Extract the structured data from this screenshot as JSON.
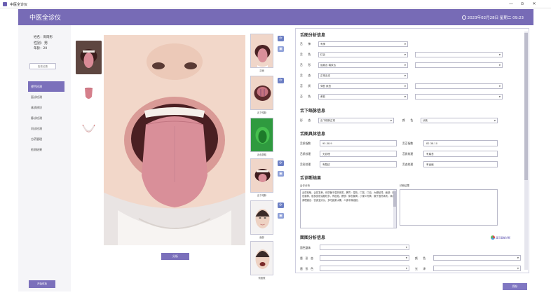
{
  "window": {
    "title": "中医全诊仪",
    "controls": {
      "minimize": "—",
      "restore": "⊙",
      "close": "✕"
    }
  },
  "header": {
    "title": "中医全诊仪",
    "datetime": "2023年02月28日 星期二 09:23"
  },
  "patient": {
    "name": "姓名：周雨彤",
    "gender": "性别：男",
    "age": "年龄：20"
  },
  "sidebar": {
    "history_button": "历史记录",
    "nav": [
      "望舌检测",
      "面诊检测",
      "体质辨识",
      "脉诊检测",
      "问诊检测",
      "方药管理",
      "检测结果"
    ],
    "active_index": 0,
    "reset_button": "开始体检"
  },
  "main": {
    "analyze_button": "分析"
  },
  "thumbs": {
    "labels": [
      "正面",
      "舌下络脉",
      "舌色提取",
      "舌下络脉",
      "面部",
      "侧面照"
    ]
  },
  "panel": {
    "tongue_section": {
      "title": "舌图分析信息",
      "rows": [
        {
          "label": "舌　　神",
          "value": "有神",
          "extra": false
        },
        {
          "label": "舌　　色",
          "value": "红舌",
          "extra": true
        },
        {
          "label": "舌　　形",
          "value": "齿痕舌 裂纹舌",
          "extra": true
        },
        {
          "label": "舌　　态",
          "value": "正常舌态",
          "extra": false
        },
        {
          "label": "苔　　质",
          "value": "薄苔 腻苔",
          "extra": true
        },
        {
          "label": "苔　　色",
          "value": "黄苔",
          "extra": true
        }
      ]
    },
    "sublingual_section": {
      "title": "舌下络脉信息",
      "shape_label": "形　　态",
      "shape_value": "舌下络脉正常",
      "color_label": "颜　　色",
      "color_value": "淡紫"
    },
    "indicator_section": {
      "title": "舌图具体信息",
      "fields": [
        {
          "label": "舌质指数",
          "value": "95.38.9"
        },
        {
          "label": "舌苔指数",
          "value": "82.38.10"
        },
        {
          "label": "舌质纹理",
          "value": "无纹理"
        },
        {
          "label": "苔质纹理",
          "value": "有腐苔"
        },
        {
          "label": "舌形纹理",
          "value": "有裂纹"
        },
        {
          "label": "舌态纹理",
          "value": "有齿痕"
        }
      ]
    },
    "diagnosis_section": {
      "title": "舌诊断结果",
      "left_label": "舌诊分析",
      "left_text": "舌质较暗，舌苔发黄，体质偏于湿热体质。脾胃：湿热。口苦，口臭，大便黏滞。面部：颜色偏黄，脸部皮肤油脂较多，有痘痘。膀胱：尿色偏黄，小便少而黄，偏于湿热体质。体质调理建议：饮食宜清淡，多吃蔬菜水果，少食辛辣油腻。",
      "right_label": "诊断结果"
    },
    "face_section": {
      "title": "面图分析信息",
      "rows": [
        "面色整体",
        "唇　形　态",
        "唇　形　色"
      ],
      "side_labels": [
        "颜　　色",
        "光　　泽"
      ],
      "face_link": "显示面部诊断"
    }
  },
  "confirm_button": "保存",
  "colors": {
    "accent": "#776bb6",
    "active_nav": "#7b70bb",
    "thumb_green": "#2f9a3f"
  }
}
